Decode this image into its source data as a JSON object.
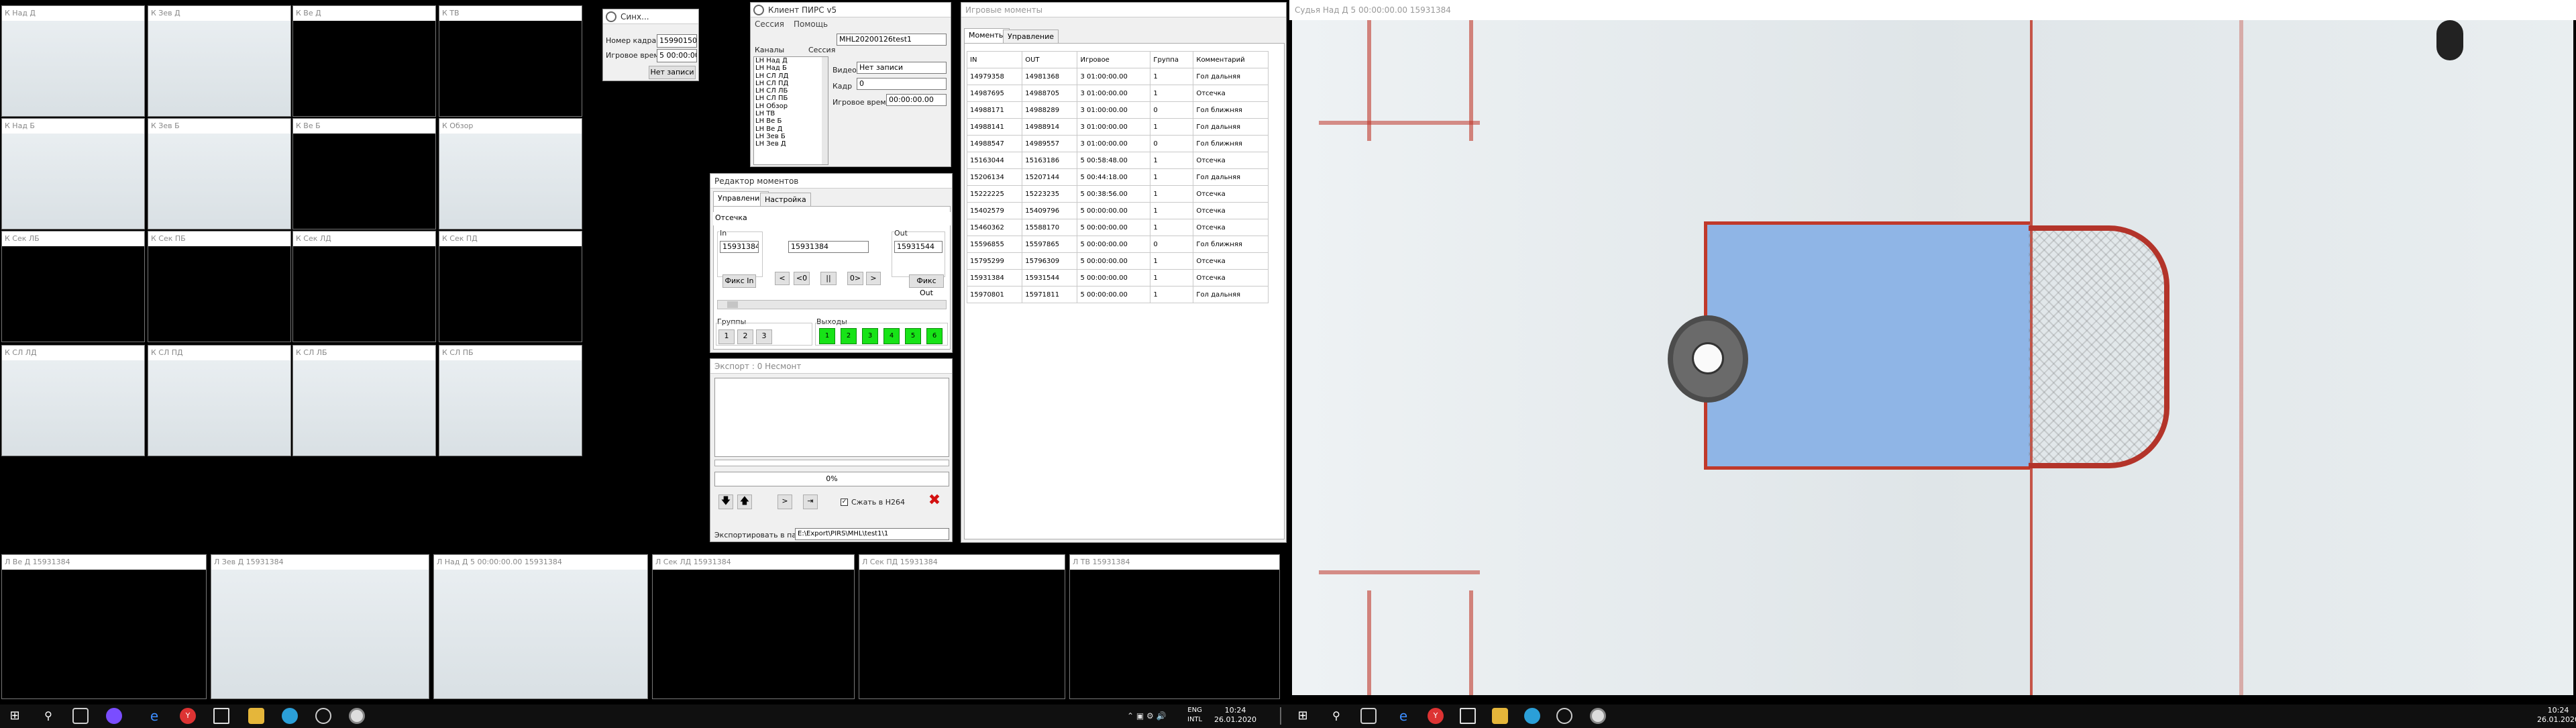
{
  "cams_top": [
    {
      "label": "К Над Д",
      "video": "ice"
    },
    {
      "label": "К Зев Д",
      "video": "ice"
    },
    {
      "label": "К Ве Д",
      "video": "black"
    },
    {
      "label": "К ТВ",
      "video": "black"
    },
    {
      "label": "К Над Б",
      "video": "ice"
    },
    {
      "label": "К Зев Б",
      "video": "ice"
    },
    {
      "label": "К Ве Б",
      "video": "black"
    },
    {
      "label": "К Обзор",
      "video": "ice"
    },
    {
      "label": "К Сек ЛБ",
      "video": "black"
    },
    {
      "label": "К Сек ПБ",
      "video": "black"
    },
    {
      "label": "К Сек ЛД",
      "video": "black"
    },
    {
      "label": "К Сек ПД",
      "video": "black"
    },
    {
      "label": "К СЛ ЛД",
      "video": "ice"
    },
    {
      "label": "К СЛ ПД",
      "video": "ice"
    },
    {
      "label": "К СЛ ЛБ",
      "video": "ice"
    },
    {
      "label": "К СЛ ПБ",
      "video": "ice"
    }
  ],
  "cams_bottom": [
    {
      "label": "Л Ве Д 15931384",
      "video": "black"
    },
    {
      "label": "Л Зев Д 15931384",
      "video": "ice"
    },
    {
      "label": "Л Над Д 5 00:00:00.00 15931384",
      "video": "ice"
    },
    {
      "label": "Л Сек ЛД 15931384",
      "video": "black"
    },
    {
      "label": "Л Сек ПД 15931384",
      "video": "black"
    },
    {
      "label": "Л ТВ 15931384",
      "video": "black"
    }
  ],
  "sync_win": {
    "title": "Синх...",
    "frame_label": "Номер кадра",
    "frame_value": "15990150",
    "time_label": "Игровое время",
    "time_value": "5 00:00:00.00",
    "button": "Нет записи"
  },
  "client_win": {
    "title": "Клиент ПИРС v5",
    "menu": [
      "Сессия",
      "Помощь"
    ],
    "session_name": "MHL20200126test1",
    "channels_header": "Каналы",
    "session_header": "Сессия",
    "channels": [
      "LH Над Д",
      "LH Над Б",
      "LH СЛ ЛД",
      "LH СЛ ПД",
      "LH СЛ ЛБ",
      "LH СЛ ПБ",
      "LH Обзор",
      "LH ТВ",
      "LH Ве Б",
      "LH Ве Д",
      "LH Зев Б",
      "LH Зев Д"
    ],
    "video_label": "Видео",
    "video_value": "Нет записи",
    "frame_label": "Кадр",
    "frame_value": "0",
    "time_label": "Игровое время",
    "time_value": "00:00:00.00"
  },
  "editor_win": {
    "title": "Редактор моментов",
    "tabs": [
      "Управление",
      "Настройка"
    ],
    "moment_name": "Отсечка",
    "in_label": "In",
    "in_value": "15931384",
    "cur_value": "15931384",
    "out_label": "Out",
    "out_value": "15931544",
    "fix_in": "Фикс In",
    "fix_out": "Фикс Out",
    "nav": [
      "<",
      "<0",
      "||",
      "0>",
      ">"
    ],
    "groups_label": "Группы",
    "groups": [
      "1",
      "2",
      "3"
    ],
    "outputs_label": "Выходы",
    "outputs": [
      "1",
      "2",
      "3",
      "4",
      "5",
      "6"
    ]
  },
  "export_win": {
    "title": "Экспорт : 0 Несмонт",
    "progress": "0%",
    "progress_value": 0,
    "compress_label": "Сжать в  H264",
    "compress_checked": true,
    "folder_label": "Экспортировать в папку",
    "folder_value": "E:\\Export\\PIRS\\MHL\\test1\\1"
  },
  "moments_win": {
    "title": "Игровые моменты",
    "tabs": [
      "Моменты",
      "Управление"
    ],
    "columns": [
      "IN",
      "OUT",
      "Игровое",
      "Группа",
      "Комментарий"
    ],
    "rows": [
      [
        "14979358",
        "14981368",
        "3 01:00:00.00",
        "1",
        "Гол дальняя"
      ],
      [
        "14987695",
        "14988705",
        "3 01:00:00.00",
        "1",
        "Отсечка"
      ],
      [
        "14988171",
        "14988289",
        "3 01:00:00.00",
        "0",
        "Гол ближняя"
      ],
      [
        "14988141",
        "14988914",
        "3 01:00:00.00",
        "1",
        "Гол дальняя"
      ],
      [
        "14988547",
        "14989557",
        "3 01:00:00.00",
        "0",
        "Гол ближняя"
      ],
      [
        "15163044",
        "15163186",
        "5 00:58:48.00",
        "1",
        "Отсечка"
      ],
      [
        "15206134",
        "15207144",
        "5 00:44:18.00",
        "1",
        "Гол дальняя"
      ],
      [
        "15222225",
        "15223235",
        "5 00:38:56.00",
        "1",
        "Отсечка"
      ],
      [
        "15402579",
        "15409796",
        "5 00:00:00.00",
        "1",
        "Отсечка"
      ],
      [
        "15460362",
        "15588170",
        "5 00:00:00.00",
        "1",
        "Отсечка"
      ],
      [
        "15596855",
        "15597865",
        "5 00:00:00.00",
        "0",
        "Гол ближняя"
      ],
      [
        "15795299",
        "15796309",
        "5 00:00:00.00",
        "1",
        "Отсечка"
      ],
      [
        "15931384",
        "15931544",
        "5 00:00:00.00",
        "1",
        "Отсечка"
      ],
      [
        "15970801",
        "15971811",
        "5 00:00:00.00",
        "1",
        "Гол дальняя"
      ]
    ]
  },
  "main_video": {
    "label": "Судья Над Д 5 00:00:00.00 15931384"
  },
  "taskbar_left": {
    "lang": "ENG",
    "lang2": "INTL",
    "time": "10:24",
    "date": "26.01.2020"
  },
  "taskbar_right": {
    "time": "10:24",
    "date": "26.01.2020"
  },
  "colors": {
    "accent": "#17e317",
    "ice": "#e4eaed",
    "crease": "#6f9fdc",
    "red_line": "#c0392b"
  }
}
